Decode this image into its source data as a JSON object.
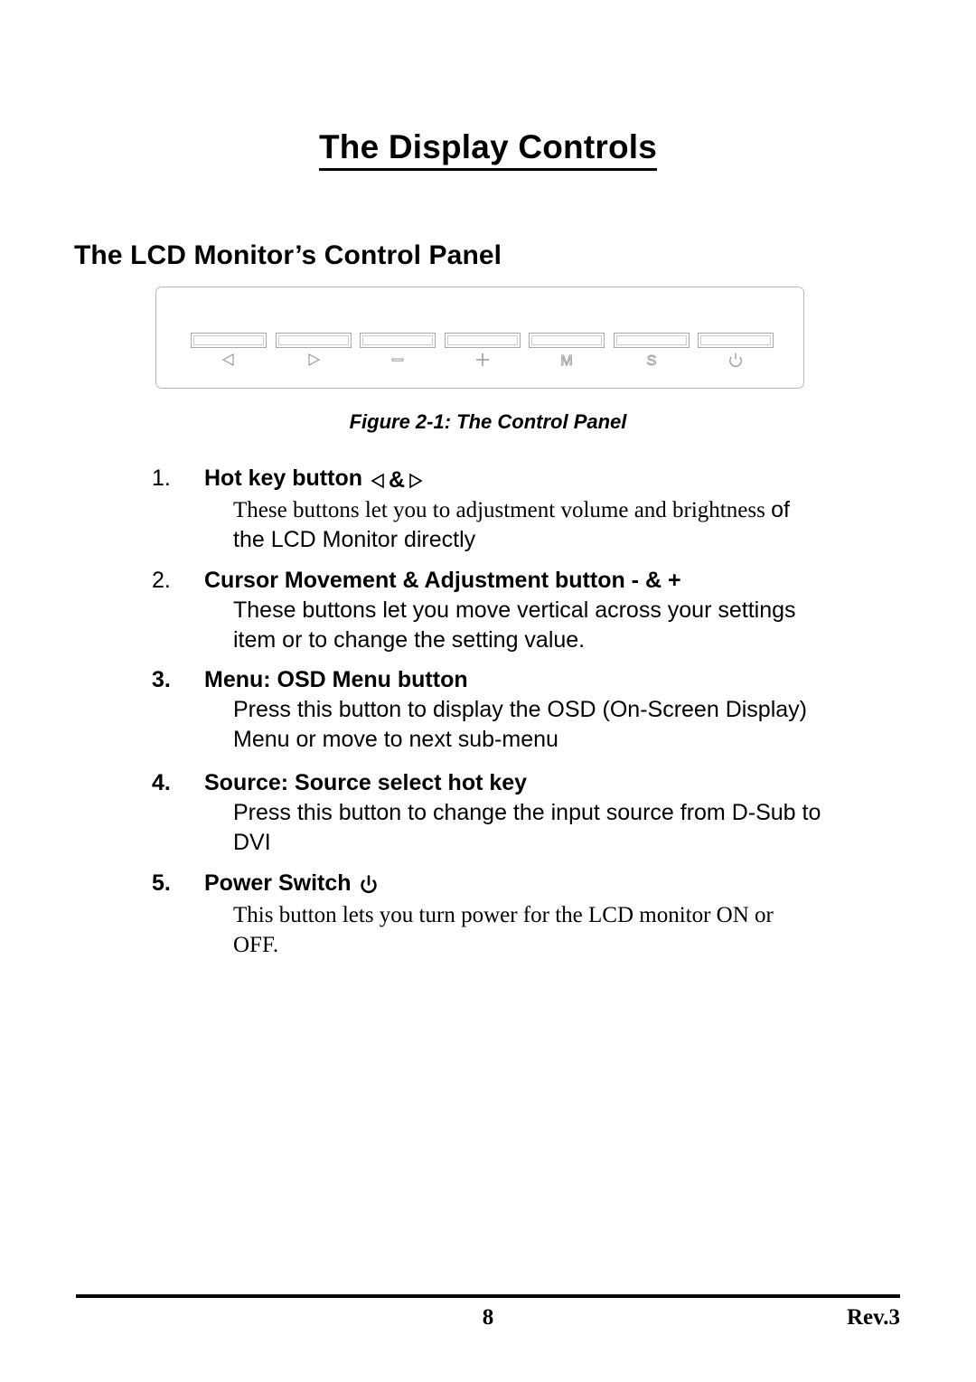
{
  "document": {
    "title": "The Display Controls",
    "section_heading": "The LCD Monitor’s Control Panel",
    "figure_caption": "Figure 2-1: The Control Panel"
  },
  "control_panel": {
    "buttons": [
      {
        "icon": "left-triangle-icon",
        "label": "◁"
      },
      {
        "icon": "right-triangle-icon",
        "label": "▷"
      },
      {
        "icon": "minus-icon",
        "label": "−"
      },
      {
        "icon": "plus-icon",
        "label": "+"
      },
      {
        "icon": "menu-m-icon",
        "label": "M"
      },
      {
        "icon": "source-s-icon",
        "label": "S"
      },
      {
        "icon": "power-icon",
        "label": "⏻"
      }
    ]
  },
  "list": {
    "items": [
      {
        "number": "1.",
        "heading": "Hot key button",
        "heading_glyphs": "◁ &▷",
        "body_line_1_serif": "These buttons let you to adjustment volume and brightness ",
        "body_line_1_sans": "of",
        "body_line_2": "the LCD Monitor directly"
      },
      {
        "number": "2.",
        "heading": "Cursor Movement & Adjustment button - & +",
        "body_line_1": "These buttons let you move vertical across your settings",
        "body_line_2": "item or to change the setting value."
      },
      {
        "number": "3.",
        "heading": "Menu: OSD Menu button",
        "body_line_1": "Press this button to display the OSD (On-Screen Display)",
        "body_line_2": "Menu or move to next sub-menu"
      },
      {
        "number": "4.",
        "heading": "Source: Source select hot key",
        "body_line_1": "Press this button to change the input source from D-Sub to",
        "body_line_2": "DVI"
      },
      {
        "number": "5.",
        "heading": "Power Switch",
        "heading_glyphs": "⏻",
        "body_line_1": "This button lets you turn power for the LCD monitor ON or",
        "body_line_2": "OFF."
      }
    ]
  },
  "footer": {
    "page_number": "8",
    "revision": "Rev.3"
  }
}
